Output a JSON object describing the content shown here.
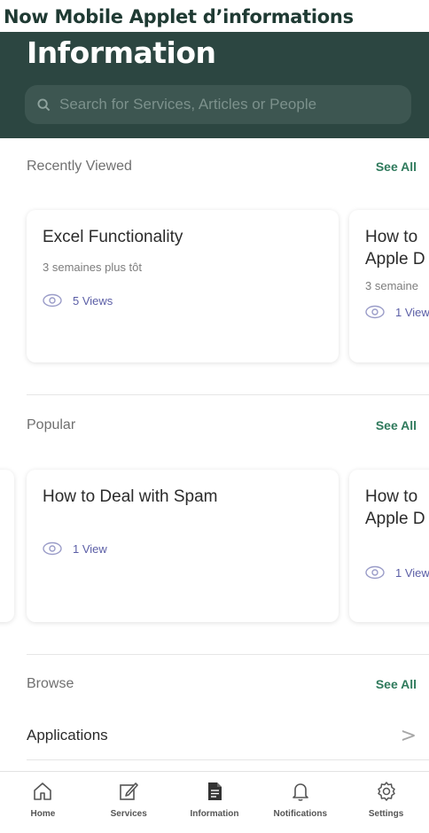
{
  "doc_title": "Now Mobile Applet d’informations",
  "header": {
    "title": "Information",
    "search_placeholder": "Search for Services, Articles or People"
  },
  "recently_viewed": {
    "label": "Recently Viewed",
    "see_all": "See All",
    "cards": [
      {
        "title": "Excel Functionality",
        "date": "3 semaines plus tôt",
        "views": "5 Views"
      },
      {
        "title": "How to \nApple D",
        "date": "3 semaine",
        "views": "1 View"
      }
    ]
  },
  "popular": {
    "label": "Popular",
    "see_all": "See All",
    "cards": [
      {
        "title": "How to Deal with Spam",
        "views": "1 View"
      },
      {
        "title": "How to \nApple D",
        "views": "1 View"
      }
    ]
  },
  "browse": {
    "label": "Browse",
    "see_all": "See All",
    "items": [
      {
        "label": "Applications",
        "chevron": ">"
      }
    ]
  },
  "tabs": [
    {
      "label": "Home",
      "icon": "home-icon"
    },
    {
      "label": "Services",
      "icon": "services-icon"
    },
    {
      "label": "Information",
      "icon": "information-icon",
      "active": true
    },
    {
      "label": "Notifications",
      "icon": "notifications-icon"
    },
    {
      "label": "Settings",
      "icon": "settings-icon"
    }
  ],
  "colors": {
    "header_bg": "#2c4641",
    "accent_green": "#2f7a5c",
    "views_purple": "#5b5ea6"
  }
}
